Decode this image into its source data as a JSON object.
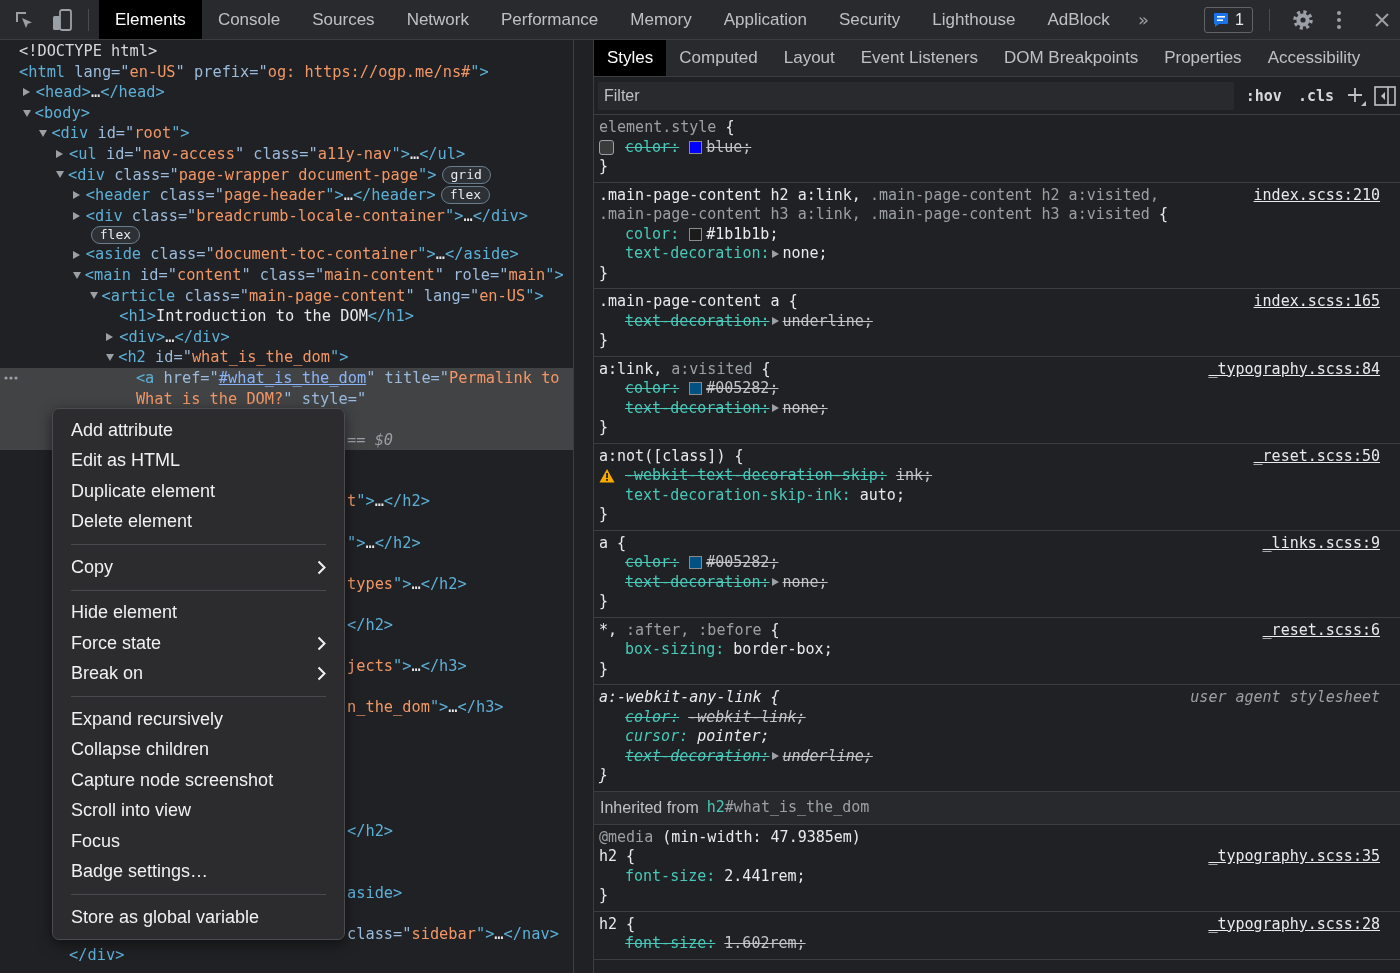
{
  "toolbar": {
    "tabs": [
      {
        "label": "Elements",
        "selected": true
      },
      {
        "label": "Console",
        "selected": false
      },
      {
        "label": "Sources",
        "selected": false
      },
      {
        "label": "Network",
        "selected": false
      },
      {
        "label": "Performance",
        "selected": false
      },
      {
        "label": "Memory",
        "selected": false
      },
      {
        "label": "Application",
        "selected": false
      },
      {
        "label": "Security",
        "selected": false
      },
      {
        "label": "Lighthouse",
        "selected": false
      },
      {
        "label": "AdBlock",
        "selected": false
      }
    ],
    "more_tabs": "»",
    "issues": {
      "count": "1"
    }
  },
  "elements_panel": {
    "nodes": [
      {
        "selected": false,
        "segments": [
          {
            "kind": "doctype",
            "text": "<!DOCTYPE html>"
          }
        ]
      },
      {
        "selected": false,
        "segments": [
          {
            "kind": "tag",
            "text": "<html"
          },
          {
            "kind": "attr",
            "text": " lang=\""
          },
          {
            "kind": "value",
            "text": "en-US"
          },
          {
            "kind": "attr",
            "text": "\" prefix=\""
          },
          {
            "kind": "value",
            "text": "og: https://ogp.me/ns#"
          },
          {
            "kind": "tag",
            "text": "\">"
          }
        ],
        "children": [
          {
            "selected": false,
            "expanded": false,
            "segments": [
              {
                "kind": "tag",
                "text": "<head>"
              },
              {
                "kind": "text",
                "text": "…"
              },
              {
                "kind": "tag",
                "text": "</head>"
              }
            ]
          },
          {
            "selected": false,
            "expanded": true,
            "segments": [
              {
                "kind": "tag",
                "text": "<body>"
              }
            ],
            "children": [
              {
                "selected": false,
                "expanded": true,
                "segments": [
                  {
                    "kind": "tag",
                    "text": "<div"
                  },
                  {
                    "kind": "attr",
                    "text": " id=\""
                  },
                  {
                    "kind": "value",
                    "text": "root"
                  },
                  {
                    "kind": "tag",
                    "text": "\">"
                  }
                ],
                "children": [
                  {
                    "selected": false,
                    "expanded": false,
                    "segments": [
                      {
                        "kind": "tag",
                        "text": "<ul"
                      },
                      {
                        "kind": "attr",
                        "text": " id=\""
                      },
                      {
                        "kind": "value",
                        "text": "nav-access"
                      },
                      {
                        "kind": "attr",
                        "text": "\" class=\""
                      },
                      {
                        "kind": "value",
                        "text": "a11y-nav"
                      },
                      {
                        "kind": "tag",
                        "text": "\">"
                      },
                      {
                        "kind": "text",
                        "text": "…"
                      },
                      {
                        "kind": "tag",
                        "text": "</ul>"
                      }
                    ]
                  },
                  {
                    "selected": false,
                    "expanded": true,
                    "badge": "grid",
                    "segments": [
                      {
                        "kind": "tag",
                        "text": "<div"
                      },
                      {
                        "kind": "attr",
                        "text": " class=\""
                      },
                      {
                        "kind": "value",
                        "text": "page-wrapper document-page"
                      },
                      {
                        "kind": "tag",
                        "text": "\">"
                      }
                    ],
                    "children": [
                      {
                        "selected": false,
                        "expanded": false,
                        "badge": "flex",
                        "segments": [
                          {
                            "kind": "tag",
                            "text": "<header"
                          },
                          {
                            "kind": "attr",
                            "text": " class=\""
                          },
                          {
                            "kind": "value",
                            "text": "page-header"
                          },
                          {
                            "kind": "tag",
                            "text": "\">"
                          },
                          {
                            "kind": "text",
                            "text": "…"
                          },
                          {
                            "kind": "tag",
                            "text": "</header>"
                          }
                        ]
                      },
                      {
                        "selected": false,
                        "expanded": false,
                        "badge": "flex",
                        "segments": [
                          {
                            "kind": "tag",
                            "text": "<div"
                          },
                          {
                            "kind": "attr",
                            "text": " class=\""
                          },
                          {
                            "kind": "value",
                            "text": "breadcrumb-locale-container"
                          },
                          {
                            "kind": "tag",
                            "text": "\">"
                          },
                          {
                            "kind": "text",
                            "text": "…"
                          },
                          {
                            "kind": "tag",
                            "text": "</div>"
                          }
                        ]
                      },
                      {
                        "selected": false,
                        "expanded": false,
                        "segments": [
                          {
                            "kind": "tag",
                            "text": "<aside"
                          },
                          {
                            "kind": "attr",
                            "text": " class=\""
                          },
                          {
                            "kind": "value",
                            "text": "document-toc-container"
                          },
                          {
                            "kind": "tag",
                            "text": "\">"
                          },
                          {
                            "kind": "text",
                            "text": "…"
                          },
                          {
                            "kind": "tag",
                            "text": "</aside>"
                          }
                        ]
                      },
                      {
                        "selected": false,
                        "expanded": true,
                        "segments": [
                          {
                            "kind": "tag",
                            "text": "<main"
                          },
                          {
                            "kind": "attr",
                            "text": " id=\""
                          },
                          {
                            "kind": "value",
                            "text": "content"
                          },
                          {
                            "kind": "attr",
                            "text": "\" class=\""
                          },
                          {
                            "kind": "value",
                            "text": "main-content"
                          },
                          {
                            "kind": "attr",
                            "text": "\" role=\""
                          },
                          {
                            "kind": "value",
                            "text": "main"
                          },
                          {
                            "kind": "tag",
                            "text": "\">"
                          }
                        ],
                        "children": [
                          {
                            "selected": false,
                            "expanded": true,
                            "segments": [
                              {
                                "kind": "tag",
                                "text": "<article"
                              },
                              {
                                "kind": "attr",
                                "text": " class=\""
                              },
                              {
                                "kind": "value",
                                "text": "main-page-content"
                              },
                              {
                                "kind": "attr",
                                "text": "\" lang=\""
                              },
                              {
                                "kind": "value",
                                "text": "en-US"
                              },
                              {
                                "kind": "tag",
                                "text": "\">"
                              }
                            ],
                            "children": [
                              {
                                "selected": false,
                                "segments": [
                                  {
                                    "kind": "tag",
                                    "text": "<h1>"
                                  },
                                  {
                                    "kind": "text",
                                    "text": "Introduction to the DOM"
                                  },
                                  {
                                    "kind": "tag",
                                    "text": "</h1>"
                                  }
                                ]
                              },
                              {
                                "selected": false,
                                "expanded": false,
                                "segments": [
                                  {
                                    "kind": "tag",
                                    "text": "<div>"
                                  },
                                  {
                                    "kind": "text",
                                    "text": "…"
                                  },
                                  {
                                    "kind": "tag",
                                    "text": "</div>"
                                  }
                                ]
                              },
                              {
                                "selected": false,
                                "expanded": true,
                                "segments": [
                                  {
                                    "kind": "tag",
                                    "text": "<h2"
                                  },
                                  {
                                    "kind": "attr",
                                    "text": " id=\""
                                  },
                                  {
                                    "kind": "value",
                                    "text": "what_is_the_dom"
                                  },
                                  {
                                    "kind": "tag",
                                    "text": "\">"
                                  }
                                ],
                                "children": [
                                  {
                                    "selected": true,
                                    "lines": [
                                      {
                                        "segments": [
                                          {
                                            "kind": "tag",
                                            "text": "<a"
                                          },
                                          {
                                            "kind": "attr",
                                            "text": " href=\""
                                          },
                                          {
                                            "kind": "link",
                                            "text": "#what_is_the_dom"
                                          },
                                          {
                                            "kind": "attr",
                                            "text": "\" title=\""
                                          },
                                          {
                                            "kind": "value",
                                            "text": "Permalink to"
                                          }
                                        ]
                                      },
                                      {
                                        "segments": [
                                          {
                                            "kind": "value",
                                            "text": "What is the DOM?"
                                          },
                                          {
                                            "kind": "attr",
                                            "text": "\" style=\""
                                          }
                                        ]
                                      },
                                      {
                                        "kind": "covered"
                                      },
                                      {
                                        "kind": "partial",
                                        "segments": [
                                          {
                                            "kind": "dim",
                                            "text": "== $0"
                                          }
                                        ]
                                      }
                                    ]
                                  },
                                  {
                                    "kind": "covered"
                                  },
                                  {
                                    "kind": "covered"
                                  },
                                  {
                                    "kind": "partial",
                                    "segments": [
                                      {
                                        "kind": "value",
                                        "text": "t"
                                      },
                                      {
                                        "kind": "tag",
                                        "text": "\">"
                                      },
                                      {
                                        "kind": "text",
                                        "text": "…"
                                      },
                                      {
                                        "kind": "tag",
                                        "text": "</h2>"
                                      }
                                    ]
                                  },
                                  {
                                    "kind": "covered"
                                  },
                                  {
                                    "kind": "partial",
                                    "segments": [
                                      {
                                        "kind": "tag",
                                        "text": "\">"
                                      },
                                      {
                                        "kind": "text",
                                        "text": "…"
                                      },
                                      {
                                        "kind": "tag",
                                        "text": "</h2>"
                                      }
                                    ]
                                  },
                                  {
                                    "kind": "covered"
                                  },
                                  {
                                    "kind": "partial",
                                    "segments": [
                                      {
                                        "kind": "value",
                                        "text": "types"
                                      },
                                      {
                                        "kind": "tag",
                                        "text": "\">"
                                      },
                                      {
                                        "kind": "text",
                                        "text": "…"
                                      },
                                      {
                                        "kind": "tag",
                                        "text": "</h2>"
                                      }
                                    ]
                                  },
                                  {
                                    "kind": "covered"
                                  },
                                  {
                                    "kind": "partial",
                                    "segments": [
                                      {
                                        "kind": "tag",
                                        "text": "</h2>"
                                      }
                                    ]
                                  },
                                  {
                                    "kind": "covered"
                                  },
                                  {
                                    "kind": "partial",
                                    "segments": [
                                      {
                                        "kind": "value",
                                        "text": "jects"
                                      },
                                      {
                                        "kind": "tag",
                                        "text": "\">"
                                      },
                                      {
                                        "kind": "text",
                                        "text": "…"
                                      },
                                      {
                                        "kind": "tag",
                                        "text": "</h3>"
                                      }
                                    ]
                                  },
                                  {
                                    "kind": "covered"
                                  },
                                  {
                                    "kind": "partial",
                                    "segments": [
                                      {
                                        "kind": "value",
                                        "text": "n_the_dom"
                                      },
                                      {
                                        "kind": "tag",
                                        "text": "\">"
                                      },
                                      {
                                        "kind": "text",
                                        "text": "…"
                                      },
                                      {
                                        "kind": "tag",
                                        "text": "</h3>"
                                      }
                                    ]
                                  },
                                  {
                                    "kind": "covered"
                                  },
                                  {
                                    "kind": "covered"
                                  },
                                  {
                                    "kind": "covered"
                                  },
                                  {
                                    "kind": "covered"
                                  },
                                  {
                                    "kind": "covered"
                                  },
                                  {
                                    "kind": "partial",
                                    "segments": [
                                      {
                                        "kind": "tag",
                                        "text": "</h2>"
                                      }
                                    ]
                                  },
                                  {
                                    "kind": "covered"
                                  },
                                  {
                                    "kind": "covered"
                                  },
                                  {
                                    "kind": "partial",
                                    "segments": [
                                      {
                                        "kind": "tag",
                                        "text": "aside>"
                                      }
                                    ]
                                  },
                                  {
                                    "kind": "covered"
                                  },
                                  {
                                    "kind": "partial",
                                    "segments": [
                                      {
                                        "kind": "attr",
                                        "text": "class=\""
                                      },
                                      {
                                        "kind": "value",
                                        "text": "sidebar"
                                      },
                                      {
                                        "kind": "tag",
                                        "text": "\">"
                                      },
                                      {
                                        "kind": "text",
                                        "text": "…"
                                      },
                                      {
                                        "kind": "tag",
                                        "text": "</nav>"
                                      }
                                    ]
                                  }
                                ]
                              }
                            ]
                          }
                        ]
                      }
                    ],
                    "closing": [
                      {
                        "kind": "tag",
                        "text": "</div>"
                      }
                    ]
                  }
                ]
              }
            ]
          }
        ]
      }
    ],
    "context_menu": {
      "items": [
        {
          "kind": "item",
          "label": "Add attribute"
        },
        {
          "kind": "item",
          "label": "Edit as HTML"
        },
        {
          "kind": "item",
          "label": "Duplicate element"
        },
        {
          "kind": "item",
          "label": "Delete element"
        },
        {
          "kind": "separator"
        },
        {
          "kind": "item",
          "label": "Copy",
          "submenu": true
        },
        {
          "kind": "separator"
        },
        {
          "kind": "item",
          "label": "Hide element"
        },
        {
          "kind": "item",
          "label": "Force state",
          "submenu": true
        },
        {
          "kind": "item",
          "label": "Break on",
          "submenu": true
        },
        {
          "kind": "separator"
        },
        {
          "kind": "item",
          "label": "Expand recursively"
        },
        {
          "kind": "item",
          "label": "Collapse children"
        },
        {
          "kind": "item",
          "label": "Capture node screenshot"
        },
        {
          "kind": "item",
          "label": "Scroll into view"
        },
        {
          "kind": "item",
          "label": "Focus"
        },
        {
          "kind": "item",
          "label": "Badge settings…"
        },
        {
          "kind": "separator"
        },
        {
          "kind": "item",
          "label": "Store as global variable"
        }
      ]
    }
  },
  "sidebar": {
    "tabs": [
      {
        "label": "Styles",
        "selected": true
      },
      {
        "label": "Computed",
        "selected": false
      },
      {
        "label": "Layout",
        "selected": false
      },
      {
        "label": "Event Listeners",
        "selected": false
      },
      {
        "label": "DOM Breakpoints",
        "selected": false
      },
      {
        "label": "Properties",
        "selected": false
      },
      {
        "label": "Accessibility",
        "selected": false
      }
    ],
    "filter": {
      "placeholder": "Filter"
    },
    "buttons": [
      ":hov",
      ".cls"
    ],
    "rules": [
      {
        "kind": "inline",
        "selector_lines": [
          [
            {
              "text": "element.style",
              "matched": false
            },
            {
              "text": " {",
              "matched": true
            }
          ]
        ],
        "props": [
          {
            "name": "color:",
            "value": "blue;",
            "color": "#0000ff",
            "struck": true,
            "checked": false
          }
        ],
        "close": "}"
      },
      {
        "kind": "file",
        "source": "index.scss:210",
        "selector_lines": [
          [
            {
              "text": ".main-page-content h2 a:link,",
              "matched": true
            },
            {
              "text": " .main-page-content h2 a:visited,",
              "matched": false
            }
          ],
          [
            {
              "text": ".main-page-content h3 a:link, .main-page-content h3 a:visited",
              "matched": false
            },
            {
              "text": " {",
              "matched": true
            }
          ]
        ],
        "props": [
          {
            "name": "color:",
            "value": "#1b1b1b;",
            "color": "#1b1b1b",
            "struck": false
          },
          {
            "name": "text-decoration:",
            "value": "none;",
            "expandable": true,
            "struck": false
          }
        ],
        "close": "}"
      },
      {
        "kind": "file",
        "source": "index.scss:165",
        "selector_lines": [
          [
            {
              "text": ".main-page-content a {",
              "matched": true
            }
          ]
        ],
        "props": [
          {
            "name": "text-decoration:",
            "value": "underline;",
            "expandable": true,
            "struck": true
          }
        ],
        "close": "}"
      },
      {
        "kind": "file",
        "source": "_typography.scss:84",
        "selector_lines": [
          [
            {
              "text": "a:link,",
              "matched": true
            },
            {
              "text": " a:visited",
              "matched": false
            },
            {
              "text": " {",
              "matched": true
            }
          ]
        ],
        "props": [
          {
            "name": "color:",
            "value": "#005282;",
            "color": "#005282",
            "struck": true
          },
          {
            "name": "text-decoration:",
            "value": "none;",
            "expandable": true,
            "struck": true
          }
        ],
        "close": "}"
      },
      {
        "kind": "file",
        "source": "_reset.scss:50",
        "selector_lines": [
          [
            {
              "text": "a:not([class]) {",
              "matched": true
            }
          ]
        ],
        "props": [
          {
            "name": "-webkit-text-decoration-skip:",
            "value": "ink;",
            "struck": true,
            "warning": true
          },
          {
            "name": "text-decoration-skip-ink:",
            "value": "auto;",
            "struck": false
          }
        ],
        "close": "}"
      },
      {
        "kind": "file",
        "source": "_links.scss:9",
        "selector_lines": [
          [
            {
              "text": "a {",
              "matched": true
            }
          ]
        ],
        "props": [
          {
            "name": "color:",
            "value": "#005282;",
            "color": "#005282",
            "struck": true
          },
          {
            "name": "text-decoration:",
            "value": "none;",
            "expandable": true,
            "struck": true
          }
        ],
        "close": "}"
      },
      {
        "kind": "file",
        "source": "_reset.scss:6",
        "selector_lines": [
          [
            {
              "text": "*,",
              "matched": true
            },
            {
              "text": " :after, :before",
              "matched": false
            },
            {
              "text": " {",
              "matched": true
            }
          ]
        ],
        "props": [
          {
            "name": "box-sizing:",
            "value": "border-box;",
            "struck": false
          }
        ],
        "close": "}"
      },
      {
        "kind": "user-agent",
        "source": "user agent stylesheet",
        "selector_lines": [
          [
            {
              "text": "a:-webkit-any-link {",
              "matched": true
            }
          ]
        ],
        "props": [
          {
            "name": "color:",
            "value": "-webkit-link;",
            "struck": true
          },
          {
            "name": "cursor:",
            "value": "pointer;",
            "struck": false
          },
          {
            "name": "text-decoration:",
            "value": "underline;",
            "expandable": true,
            "struck": true
          }
        ],
        "close": "}"
      },
      {
        "kind": "inherited",
        "label": "Inherited from",
        "node": [
          {
            "kind": "tag",
            "text": "h2"
          },
          {
            "kind": "id",
            "text": "#what_is_the_dom"
          }
        ]
      },
      {
        "kind": "file",
        "source": "_typography.scss:35",
        "media": [
          {
            "text": "@media",
            "matched": false
          },
          {
            "text": " (min-width: 47.9385em)",
            "matched": true
          }
        ],
        "selector_lines": [
          [
            {
              "text": "h2 {",
              "matched": true
            }
          ]
        ],
        "props": [
          {
            "name": "font-size:",
            "value": "2.441rem;",
            "struck": false
          }
        ],
        "close": "}"
      },
      {
        "kind": "file",
        "source": "_typography.scss:28",
        "selector_lines": [
          [
            {
              "text": "h2 {",
              "matched": true
            }
          ]
        ],
        "props": [
          {
            "name": "font-size:",
            "value": "1.602rem;",
            "struck": true
          }
        ]
      }
    ]
  }
}
